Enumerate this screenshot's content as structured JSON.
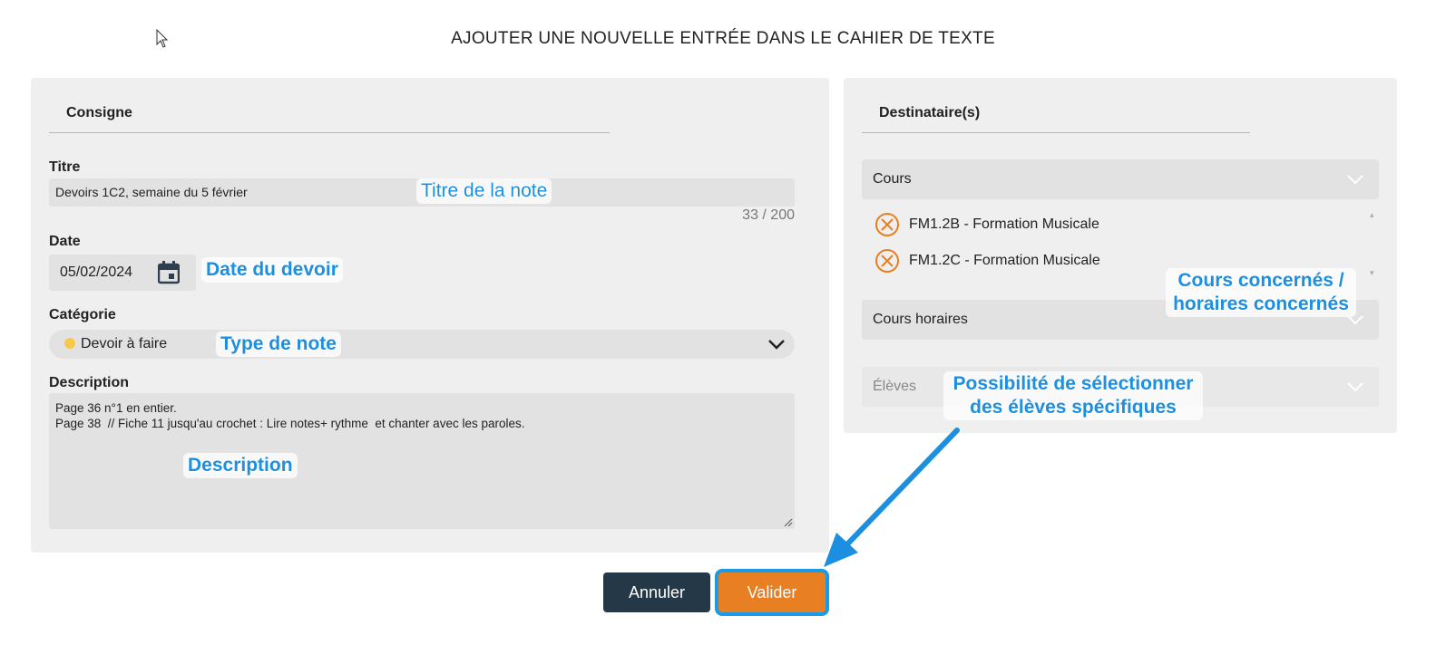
{
  "page": {
    "title": "AJOUTER UNE NOUVELLE ENTRÉE DANS LE CAHIER DE TEXTE"
  },
  "consigne": {
    "section_title": "Consigne",
    "titre": {
      "label": "Titre",
      "value": "Devoirs 1C2, semaine du 5 février",
      "counter": "33 / 200"
    },
    "date": {
      "label": "Date",
      "value": "05/02/2024",
      "icon": "calendar-icon"
    },
    "categorie": {
      "label": "Catégorie",
      "value": "Devoir à faire",
      "dot_color": "#f7c948",
      "icon": "chevron-down-icon"
    },
    "description": {
      "label": "Description",
      "line1": "Page 36 n°1 en entier.",
      "line2": "Page 38  // Fiche 11 jusqu'au crochet : Lire notes+ rythme  et chanter avec les paroles."
    }
  },
  "destinataires": {
    "section_title": "Destinataire(s)",
    "cours": {
      "label": "Cours",
      "items": [
        "FM1.2B - Formation Musicale",
        "FM1.2C - Formation Musicale"
      ]
    },
    "cours_horaires": {
      "label": "Cours horaires"
    },
    "eleves": {
      "label": "Élèves"
    }
  },
  "buttons": {
    "cancel": "Annuler",
    "validate": "Valider"
  },
  "annotations": {
    "titre": "Titre de la note",
    "date": "Date du devoir",
    "type": "Type de note",
    "description": "Description",
    "cours_line1": "Cours concernés /",
    "cours_line2": "horaires concernés",
    "eleves_line1": "Possibilité de sélectionner",
    "eleves_line2": "des élèves spécifiques"
  },
  "colors": {
    "accent_orange": "#e87f22",
    "cancel_dark": "#243847",
    "annotation_blue": "#1c8fe0",
    "remove_icon": "#e87f22"
  }
}
